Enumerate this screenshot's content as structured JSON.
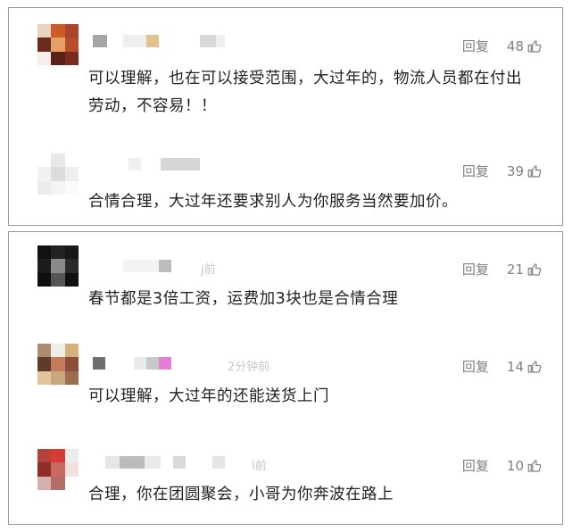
{
  "comments": [
    {
      "reply_label": "回复",
      "likes": "48",
      "time": "",
      "text": "可以理解，也在可以接受范围，大过年的，物流人员都在付出劳动，不容易！！"
    },
    {
      "reply_label": "回复",
      "likes": "39",
      "time": "",
      "text": "合情合理，大过年还要求别人为你服务当然要加价。"
    },
    {
      "reply_label": "回复",
      "likes": "21",
      "time": "j前",
      "text": "春节都是3倍工资，运费加3块也是合情合理"
    },
    {
      "reply_label": "回复",
      "likes": "14",
      "time": "2分钟前",
      "text": "可以理解，大过年的还能送货上门"
    },
    {
      "reply_label": "回复",
      "likes": "10",
      "time": "I前",
      "text": "合理，你在团圆聚会，小哥为你奔波在路上"
    }
  ],
  "colors": {
    "text": "#1f1f1f",
    "meta": "#808080",
    "border": "#9a9a9a"
  },
  "icons": {
    "like": "thumbs-up-icon"
  }
}
